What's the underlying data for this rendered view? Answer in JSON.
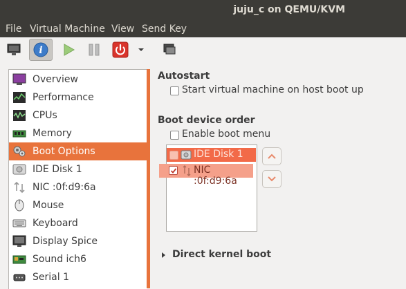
{
  "window": {
    "title": "juju_c on QEMU/KVM"
  },
  "menu": {
    "items": [
      "File",
      "Virtual Machine",
      "View",
      "Send Key"
    ]
  },
  "toolbar": {
    "buttons": [
      {
        "icon": "monitor-icon"
      },
      {
        "icon": "info-icon"
      },
      {
        "icon": "play-icon"
      },
      {
        "icon": "pause-icon"
      },
      {
        "icon": "power-icon"
      },
      {
        "icon": "dropdown-arrow-icon"
      },
      {
        "icon": "screenshot-icon"
      }
    ]
  },
  "sidebar": {
    "items": [
      {
        "label": "Overview",
        "icon": "overview-icon"
      },
      {
        "label": "Performance",
        "icon": "performance-icon"
      },
      {
        "label": "CPUs",
        "icon": "cpu-icon"
      },
      {
        "label": "Memory",
        "icon": "memory-icon"
      },
      {
        "label": "Boot Options",
        "icon": "boot-options-icon",
        "selected": true
      },
      {
        "label": "IDE Disk 1",
        "icon": "disk-icon"
      },
      {
        "label": "NIC :0f:d9:6a",
        "icon": "network-icon"
      },
      {
        "label": "Mouse",
        "icon": "mouse-icon"
      },
      {
        "label": "Keyboard",
        "icon": "keyboard-icon"
      },
      {
        "label": "Display Spice",
        "icon": "display-icon"
      },
      {
        "label": "Sound ich6",
        "icon": "sound-icon"
      },
      {
        "label": "Serial 1",
        "icon": "serial-icon"
      }
    ]
  },
  "autostart": {
    "title": "Autostart",
    "checkbox_label": "Start virtual machine on host boot up",
    "checked": false
  },
  "boot_order": {
    "title": "Boot device order",
    "enable_menu_label": "Enable boot menu",
    "enable_menu_checked": false,
    "devices": [
      {
        "label": "IDE Disk 1",
        "checked": false,
        "icon": "disk-icon"
      },
      {
        "label": "NIC :0f:d9:6a",
        "checked": true,
        "icon": "network-icon"
      }
    ]
  },
  "direct_kernel": {
    "title": "Direct kernel boot",
    "expanded": false
  },
  "colors": {
    "accent": "#e8733c",
    "titlebar": "#3c3b37",
    "highlight": "#f08f73"
  }
}
